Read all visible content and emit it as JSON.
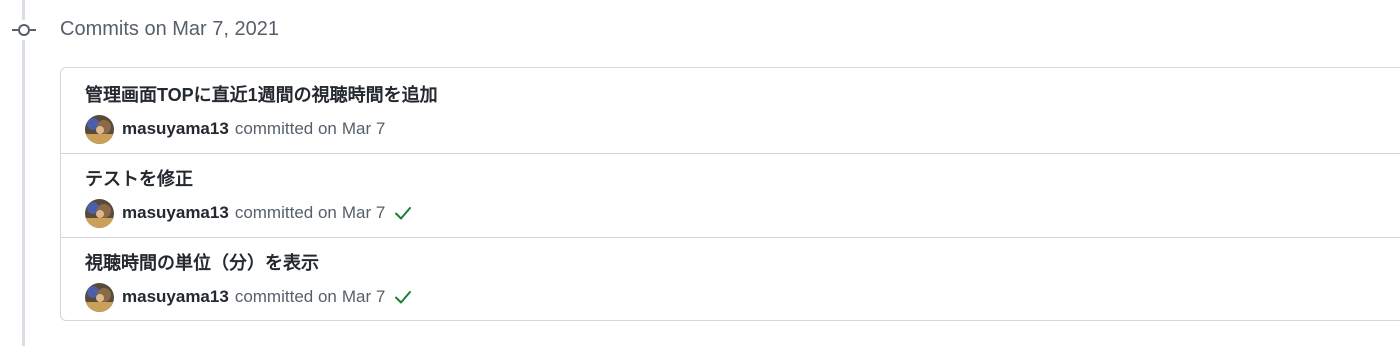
{
  "group": {
    "title": "Commits on Mar 7, 2021"
  },
  "commits": [
    {
      "message": "管理画面TOPに直近1週間の視聴時間を追加",
      "author": "masuyama13",
      "committed_text": "committed on",
      "date": "Mar 7",
      "status": "none"
    },
    {
      "message": "テストを修正",
      "author": "masuyama13",
      "committed_text": "committed on",
      "date": "Mar 7",
      "status": "success"
    },
    {
      "message": "視聴時間の単位（分）を表示",
      "author": "masuyama13",
      "committed_text": "committed on",
      "date": "Mar 7",
      "status": "success"
    }
  ],
  "icons": {
    "commit_node": "git-commit-icon",
    "status_success": "check-icon"
  },
  "colors": {
    "success": "#1a7f37",
    "muted_text": "#57606a",
    "border": "#d0d7de",
    "timeline": "#d8dee4"
  }
}
